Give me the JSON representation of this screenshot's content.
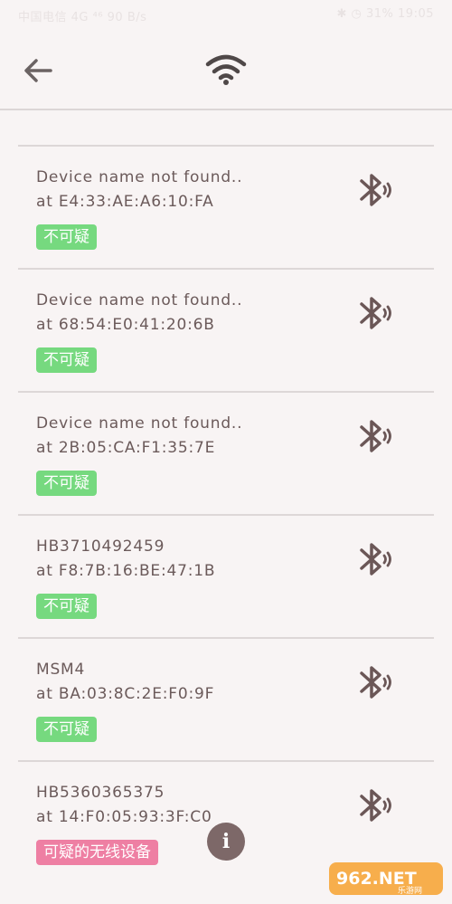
{
  "status_bar": {
    "left_text": "中国电信 4G ⁴⁶ 90 B/s",
    "right_text": "✱ ◷ 31%  19:05"
  },
  "toolbar": {
    "back_icon": "back-arrow-icon",
    "wifi_icon": "wifi-icon"
  },
  "devices": [
    {
      "name": "Device name not found..",
      "address": "at E4:33:AE:A6:10:FA",
      "status": "不可疑",
      "suspicious": false
    },
    {
      "name": "Device name not found..",
      "address": "at 68:54:E0:41:20:6B",
      "status": "不可疑",
      "suspicious": false
    },
    {
      "name": "Device name not found..",
      "address": "at 2B:05:CA:F1:35:7E",
      "status": "不可疑",
      "suspicious": false
    },
    {
      "name": "HB3710492459",
      "address": "at F8:7B:16:BE:47:1B",
      "status": "不可疑",
      "suspicious": false
    },
    {
      "name": "MSM4",
      "address": "at BA:03:8C:2E:F0:9F",
      "status": "不可疑",
      "suspicious": false
    },
    {
      "name": "HB5360365375",
      "address": "at 14:F0:05:93:3F:C0",
      "status": "可疑的无线设备",
      "suspicious": true
    }
  ],
  "info_button": {
    "label": "i",
    "icon": "info-icon"
  },
  "watermark": {
    "text": "962.NET",
    "subtext": "乐游网"
  },
  "colors": {
    "ok_badge": "#76d97f",
    "suspicious_badge": "#ee7fa3",
    "accent": "#7d6868"
  }
}
